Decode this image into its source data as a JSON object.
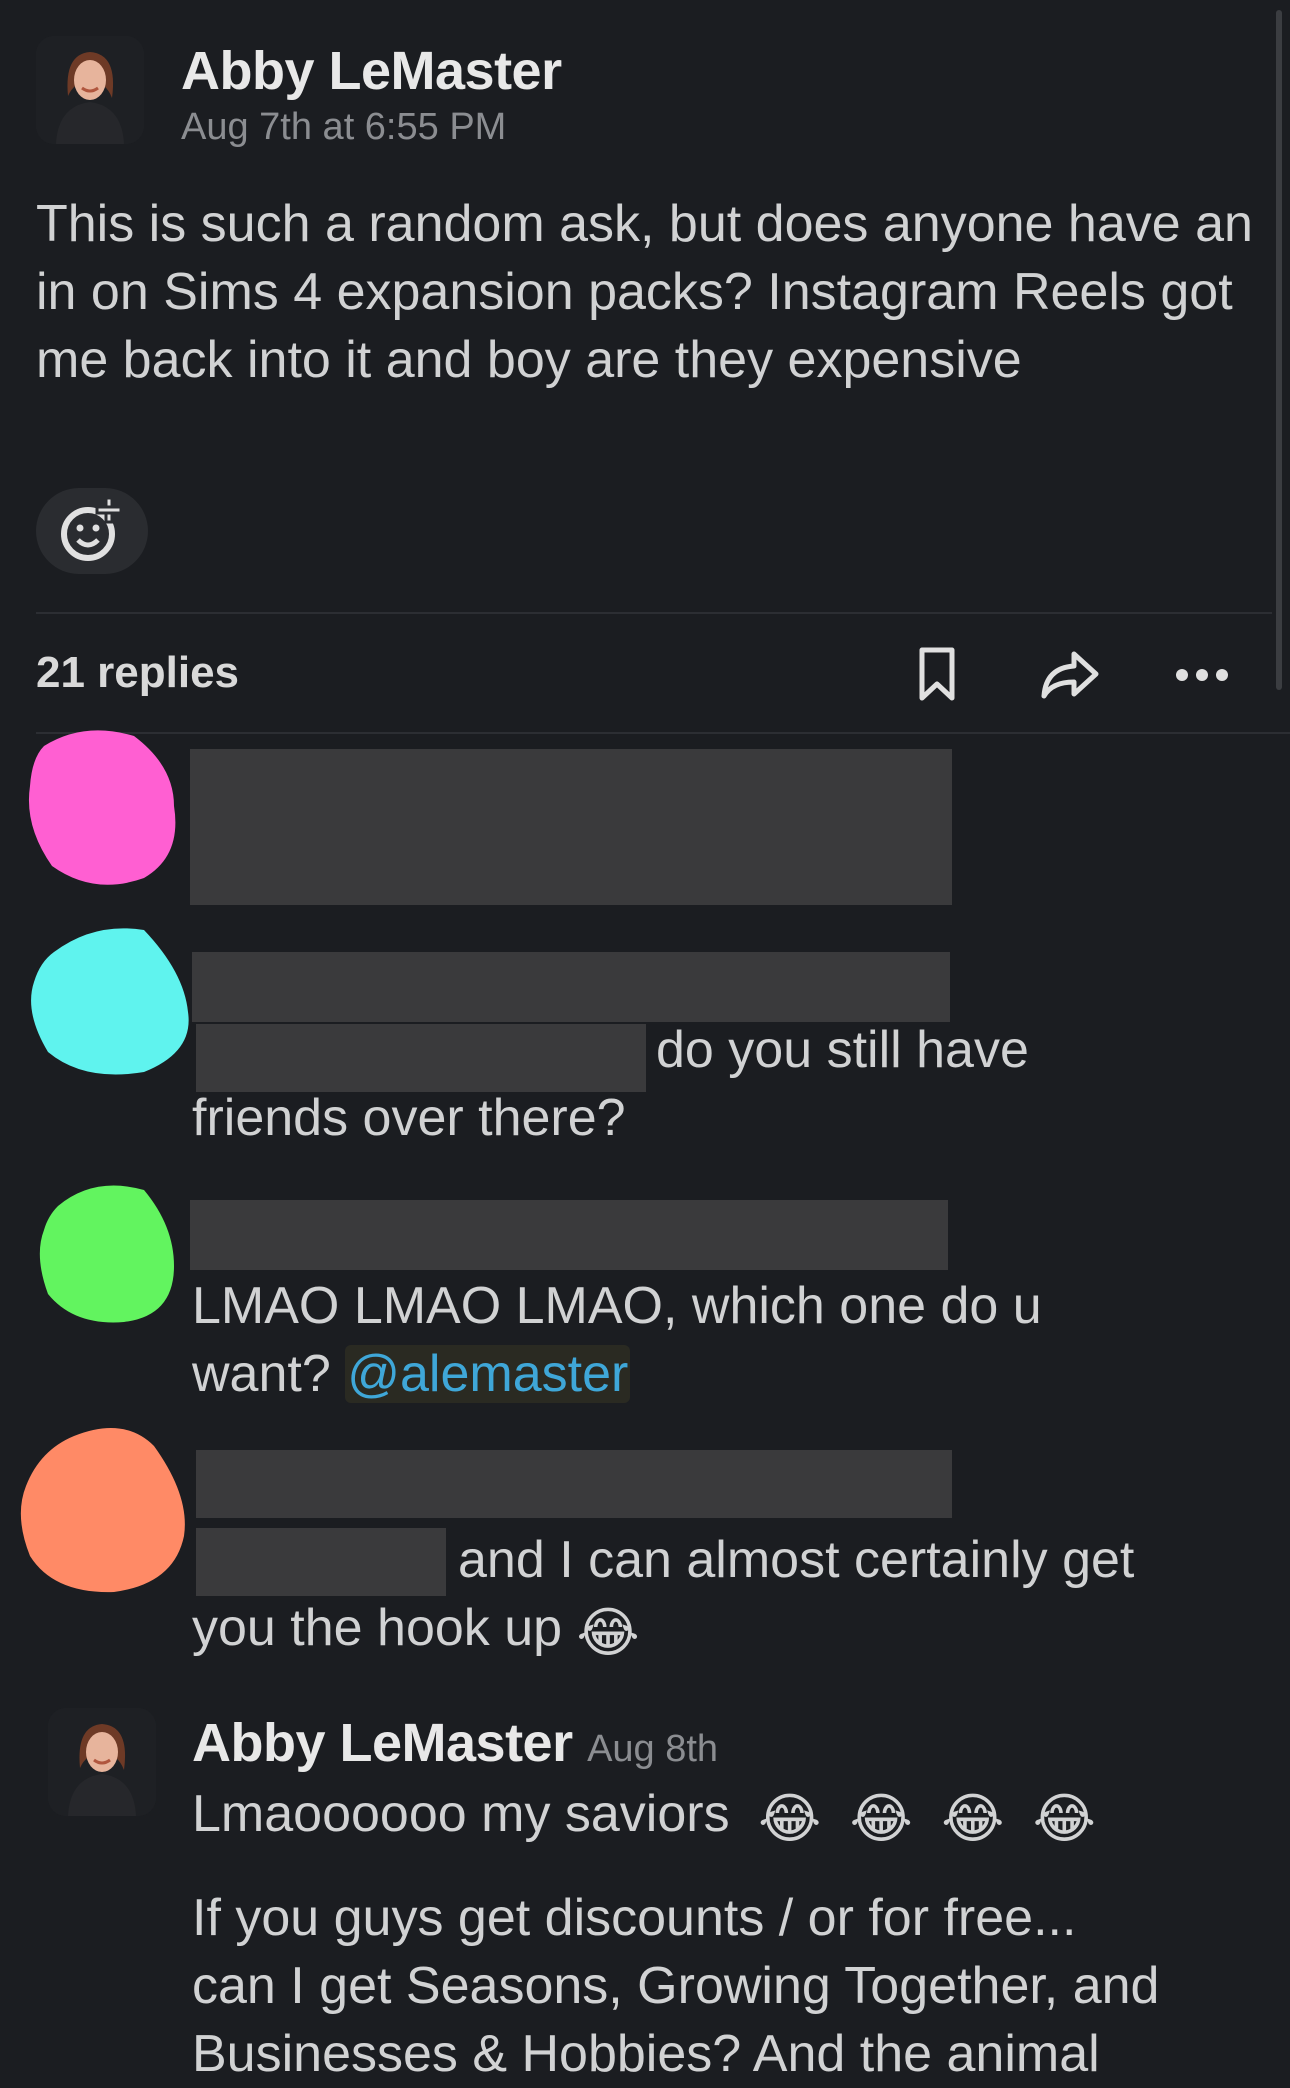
{
  "thread": {
    "author": "Abby LeMaster",
    "timestamp": "Aug 7th at 6:55 PM",
    "message": "This is such a random ask, but does anyone have an in on Sims 4 expansion packs? Instagram Reels got me back into it and boy are they expensive",
    "add_reaction_icon": "emoji-add-icon"
  },
  "replies_bar": {
    "count_label": "21 replies",
    "icons": [
      "bookmark-icon",
      "share-icon",
      "more-icon"
    ]
  },
  "replies": [
    {
      "text": ""
    },
    {
      "text_line1": "do you still have",
      "text_line2": "friends over there?"
    },
    {
      "text_line1": "LMAO LMAO LMAO, which one do u",
      "text_line2_prefix": "want?",
      "mention": "@alemaster"
    },
    {
      "text_line1": "and I can almost certainly get",
      "text_line2": "you the hook up",
      "emoji": "😂"
    }
  ],
  "last_reply": {
    "author": "Abby LeMaster",
    "timestamp": "Aug 8th",
    "line1": "Lmaoooooo my saviors",
    "line1_emoji": "😂",
    "para_line1": "If you guys get discounts / or for free...",
    "para_line2": "can I get Seasons, Growing Together, and",
    "para_line3": "Businesses & Hobbies? And the animal"
  },
  "colors": {
    "background": "#1b1d21",
    "redaction": "#3a3a3c",
    "mention": "#3fa7d8",
    "blob_pink": "#ff5fd2",
    "blob_cyan": "#5ff3ee",
    "blob_green": "#62f45f",
    "blob_orange": "#ff8a66"
  }
}
